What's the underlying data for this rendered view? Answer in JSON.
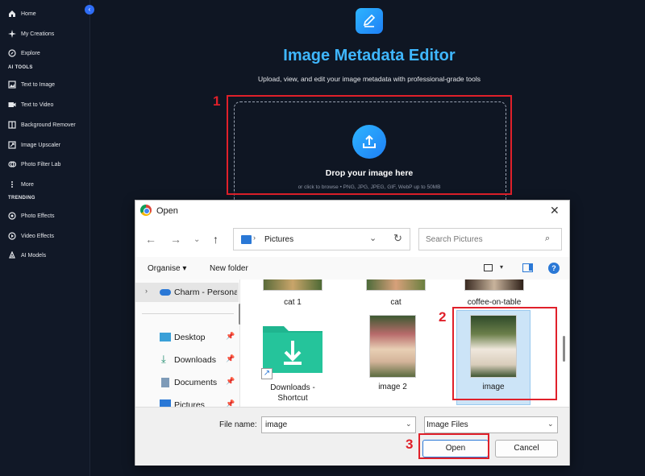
{
  "sidebar": {
    "items_top": [
      {
        "label": "Home",
        "icon": "home-icon"
      },
      {
        "label": "My Creations",
        "icon": "sparkle-icon"
      },
      {
        "label": "Explore",
        "icon": "compass-icon"
      }
    ],
    "ai_tools_header": "AI TOOLS",
    "ai_tools": [
      {
        "label": "Text to Image",
        "icon": "image-icon"
      },
      {
        "label": "Text to Video",
        "icon": "video-icon"
      },
      {
        "label": "Background Remover",
        "icon": "layers-icon"
      },
      {
        "label": "Image Upscaler",
        "icon": "upscale-icon"
      },
      {
        "label": "Photo Filter Lab",
        "icon": "filter-icon"
      },
      {
        "label": "More",
        "icon": "more-vertical-icon"
      }
    ],
    "trending_header": "TRENDING",
    "trending": [
      {
        "label": "Photo Effects",
        "icon": "effects-icon"
      },
      {
        "label": "Video Effects",
        "icon": "video-effects-icon"
      },
      {
        "label": "AI Models",
        "icon": "ai-models-icon"
      }
    ]
  },
  "main": {
    "title": "Image Metadata Editor",
    "subtitle": "Upload, view, and edit your image metadata with professional-grade tools",
    "drop_title": "Drop your image here",
    "drop_sub": "or click to browse • PNG, JPG, JPEG, GIF, WebP up to 50MB"
  },
  "annotations": [
    "1",
    "2",
    "3"
  ],
  "dialog": {
    "title": "Open",
    "close_glyph": "✕",
    "path": "Pictures",
    "search_placeholder": "Search Pictures",
    "organise": "Organise ▾",
    "new_folder": "New folder",
    "nav": [
      {
        "label": "Charm - Persona",
        "icon": "onedrive-icon",
        "pin": ""
      },
      {
        "label": "Desktop",
        "icon": "desktop-icon",
        "pin": "📌"
      },
      {
        "label": "Downloads",
        "icon": "download-icon",
        "pin": "📌"
      },
      {
        "label": "Documents",
        "icon": "documents-icon",
        "pin": "📌"
      },
      {
        "label": "Pictures",
        "icon": "pictures-icon",
        "pin": "📌"
      }
    ],
    "files_row1": [
      "cat 1",
      "cat",
      "coffee-on-table"
    ],
    "files_row2": [
      "Downloads -\nShortcut",
      "image 2",
      "image"
    ],
    "file_name_label": "File name:",
    "file_name_value": "image",
    "file_type": "Image Files",
    "open_button": "Open",
    "cancel_button": "Cancel"
  }
}
